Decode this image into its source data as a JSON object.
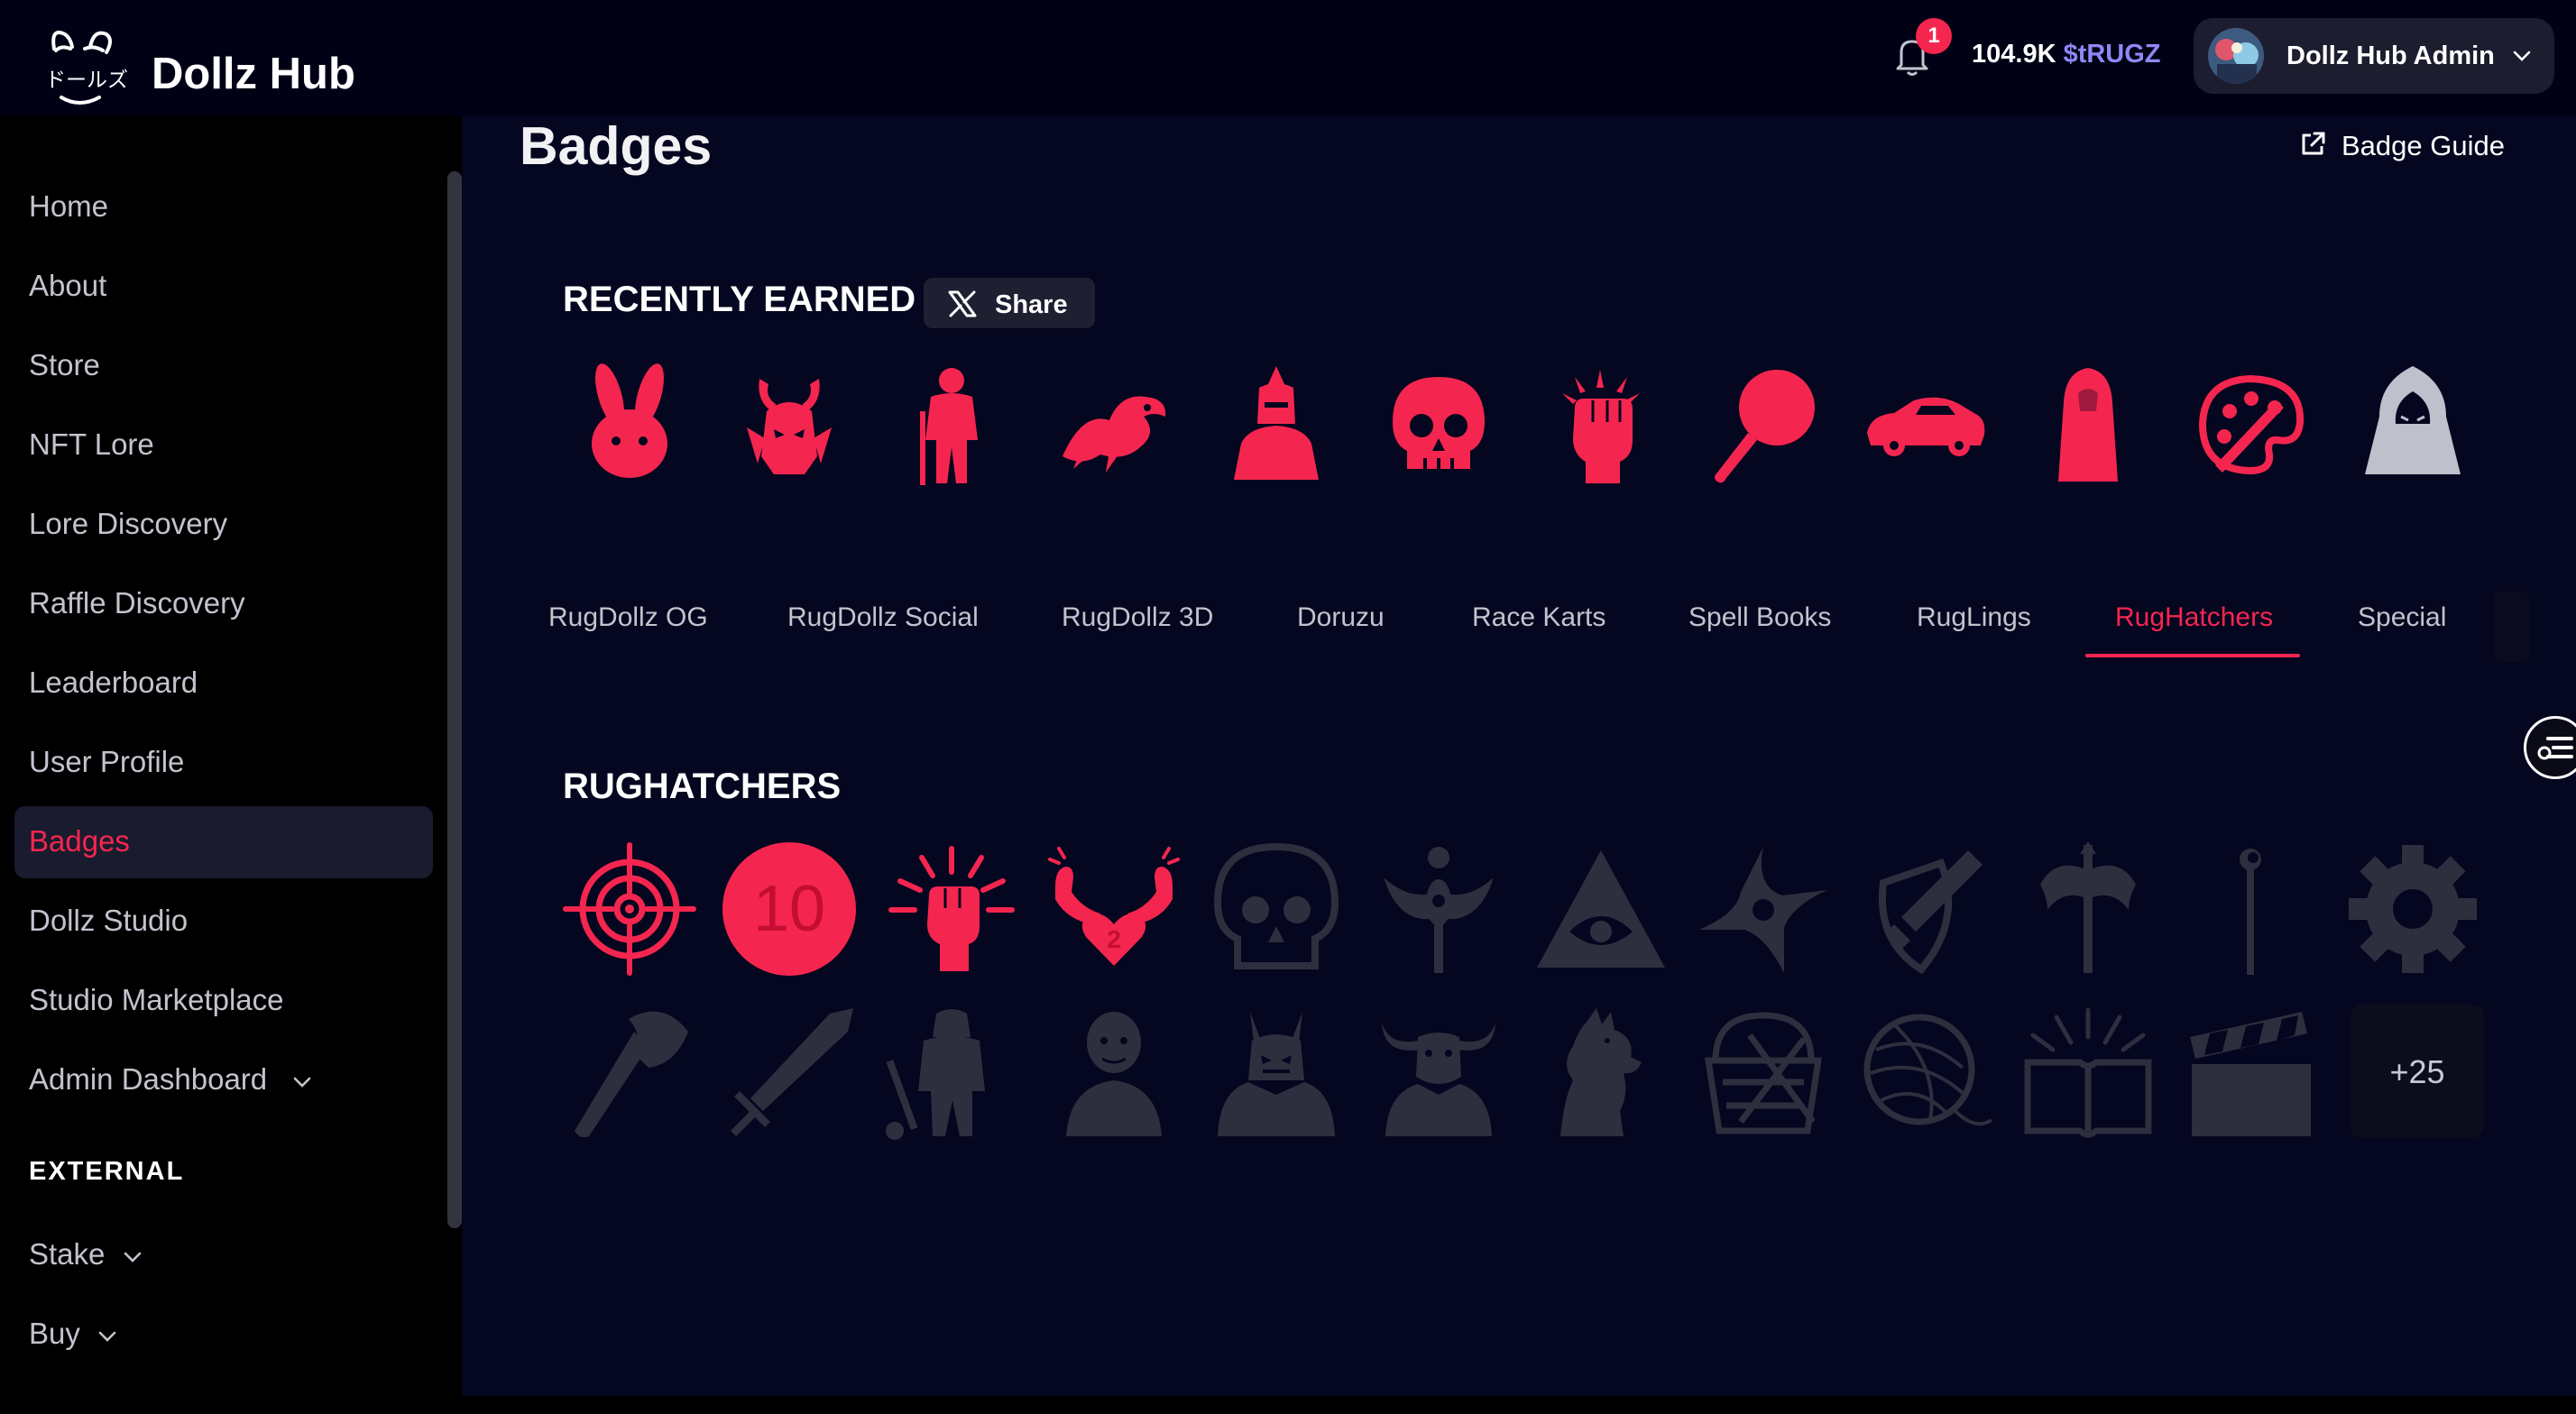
{
  "app": {
    "brand_name": "Dollz Hub",
    "logo_text": "ドールズ",
    "notification_count": "1",
    "balance_amount": "104.9K",
    "balance_ticker": "$tRUGZ",
    "user_name": "Dollz Hub Admin"
  },
  "sidebar": {
    "items": [
      {
        "label": "Home",
        "active": false
      },
      {
        "label": "About",
        "active": false
      },
      {
        "label": "Store",
        "active": false
      },
      {
        "label": "NFT Lore",
        "active": false
      },
      {
        "label": "Lore Discovery",
        "active": false
      },
      {
        "label": "Raffle Discovery",
        "active": false
      },
      {
        "label": "Leaderboard",
        "active": false
      },
      {
        "label": "User Profile",
        "active": false
      },
      {
        "label": "Badges",
        "active": true
      },
      {
        "label": "Dollz Studio",
        "active": false
      },
      {
        "label": "Studio Marketplace",
        "active": false
      },
      {
        "label": "Admin Dashboard",
        "active": false,
        "has_dropdown": true
      }
    ],
    "external_label": "EXTERNAL",
    "external_items": [
      {
        "label": "Stake",
        "has_dropdown": true
      },
      {
        "label": "Buy",
        "has_dropdown": true
      }
    ]
  },
  "page": {
    "title": "Badges",
    "guide_label": "Badge Guide"
  },
  "recent": {
    "title": "RECENTLY EARNED",
    "share_label": "Share",
    "badges": [
      "bunny-badge",
      "horned-demon-badge",
      "warrior-badge",
      "dragon-badge",
      "knight-badge",
      "skull-badge",
      "fist-badge",
      "frying-pan-badge",
      "race-car-badge",
      "hooded-figure-badge",
      "paint-palette-badge",
      "hooded-assassin-badge"
    ],
    "earned": [
      true,
      true,
      true,
      true,
      true,
      true,
      true,
      true,
      true,
      true,
      true,
      false
    ]
  },
  "tabs": {
    "items": [
      "RugDollz OG",
      "RugDollz Social",
      "RugDollz 3D",
      "Doruzu",
      "Race Karts",
      "Spell Books",
      "RugLings",
      "RugHatchers",
      "Special"
    ],
    "active": "RugHatchers"
  },
  "collection": {
    "title": "RUGHATCHERS",
    "level_badge_text": "10",
    "strength_badge_text": "2",
    "row1": [
      "crosshair-badge",
      "level-10-badge",
      "raised-fist-badge",
      "strong-heart-badge",
      "skull-badge",
      "winged-idol-badge",
      "all-seeing-eye-badge",
      "shuriken-badge",
      "shield-sword-badge",
      "battle-axe-double-badge",
      "magic-staff-badge",
      "gear-badge"
    ],
    "row1_earned": [
      true,
      true,
      true,
      true,
      false,
      false,
      false,
      false,
      false,
      false,
      false,
      false
    ],
    "row2": [
      "axe-badge",
      "sword-badge",
      "orc-warrior-badge",
      "ogre-badge",
      "demon-lord-badge",
      "horned-beast-badge",
      "werewolf-badge",
      "knitting-basket-badge",
      "yarn-ball-badge",
      "open-book-badge",
      "clapperboard-badge"
    ],
    "more_label": "+25"
  },
  "colors": {
    "accent": "#f4264f",
    "earned": "#f4264f",
    "locked": "#2e2f3e",
    "unearned_recent": "#bfc0cb",
    "page_bg": "#05061f",
    "sidebar_bg": "#000000",
    "ticker": "#8f88f4"
  }
}
